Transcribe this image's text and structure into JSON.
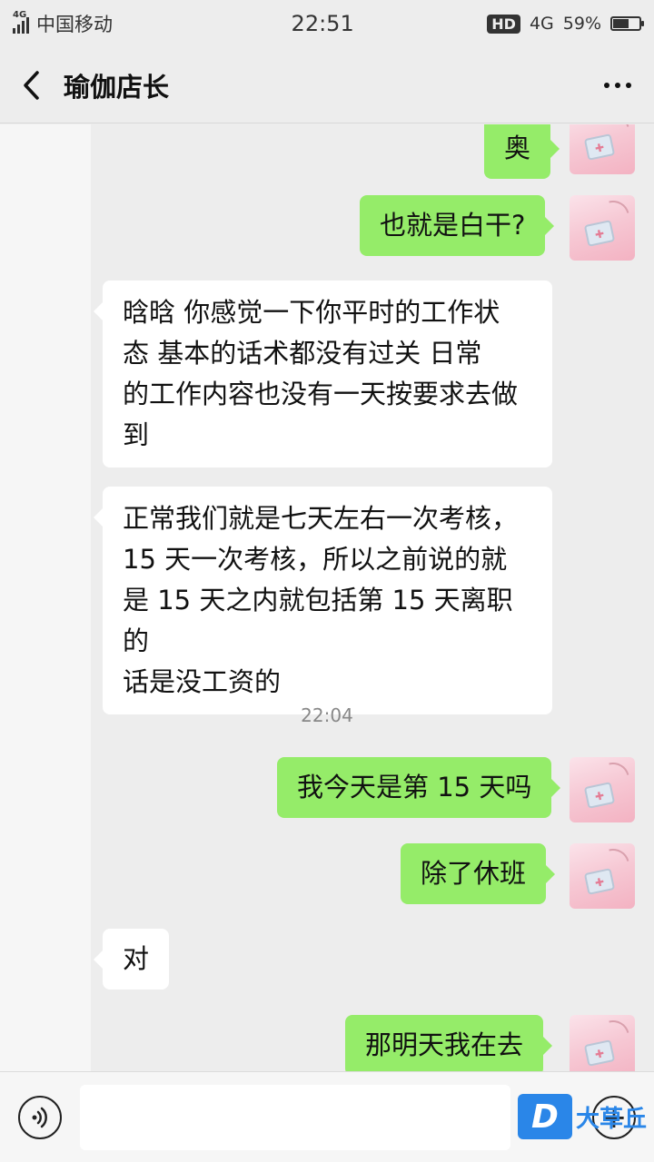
{
  "status_bar": {
    "network_tag": "4G",
    "carrier": "中国移动",
    "time": "22:51",
    "hd": "HD",
    "network": "4G",
    "battery": "59%",
    "battery_level": 0.59
  },
  "header": {
    "title": "瑜伽店长",
    "back_icon": "chevron-left-icon",
    "more_icon": "more-dots-icon"
  },
  "messages": [
    {
      "side": "out",
      "text": "奥"
    },
    {
      "side": "out",
      "text": "也就是白干?"
    },
    {
      "side": "in",
      "lines": [
        "晗晗  你感觉一下你平时的工作状",
        "态   基本的话术都没有过关   日常",
        "的工作内容也没有一天按要求去做",
        "到"
      ]
    },
    {
      "side": "in",
      "lines": [
        "正常我们就是七天左右一次考核，",
        "15 天一次考核，所以之前说的就",
        "是 15 天之内就包括第 15 天离职的",
        "话是没工资的"
      ]
    },
    {
      "side": "out",
      "text": "我今天是第 15 天吗"
    },
    {
      "side": "out",
      "text": "除了休班"
    },
    {
      "side": "in",
      "text": "对"
    },
    {
      "side": "out",
      "text": "那明天我在去"
    }
  ],
  "timestamp": "22:04",
  "input_bar": {
    "voice_icon": "voice-icon",
    "placeholder": "",
    "plus_icon": "plus-icon"
  },
  "watermark": {
    "logo": "D",
    "text": "大草丘"
  },
  "colors": {
    "outgoing_bubble": "#95ec69",
    "incoming_bubble": "#ffffff",
    "background": "#ededed"
  }
}
